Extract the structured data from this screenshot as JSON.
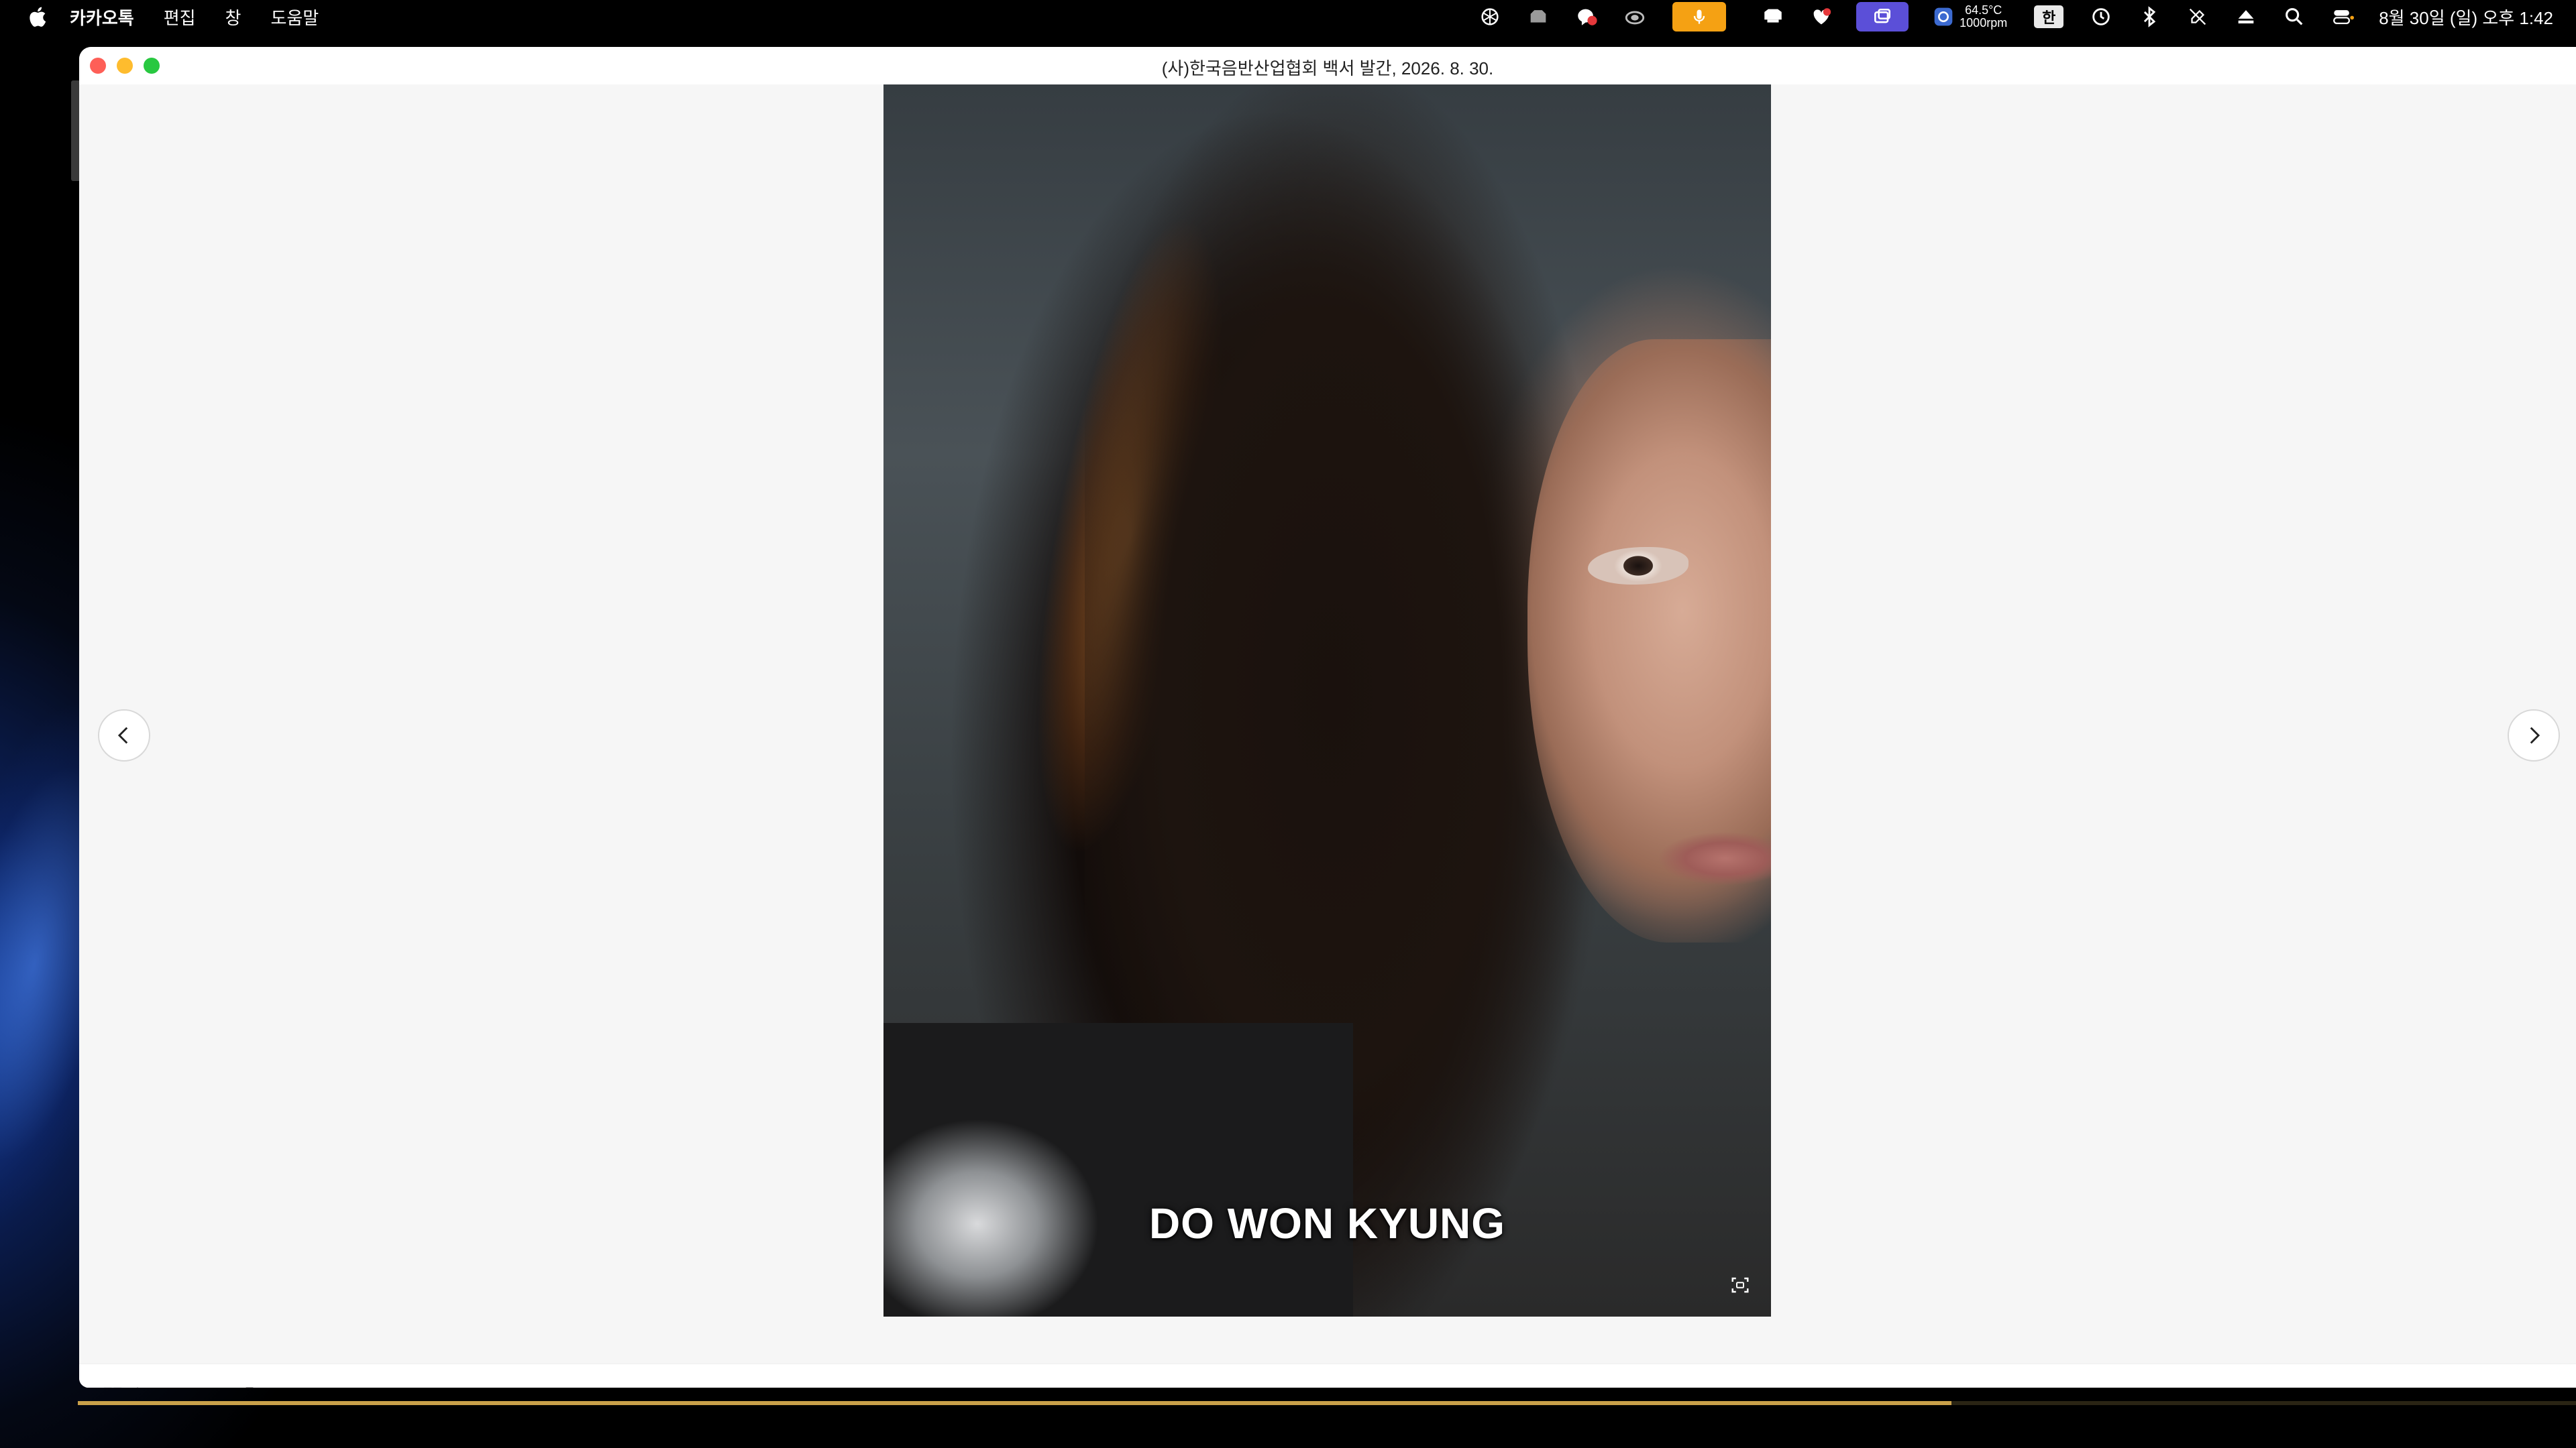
{
  "menubar": {
    "apple_icon": "apple-icon",
    "items": [
      {
        "label": "카카오톡",
        "bold": true
      },
      {
        "label": "편집",
        "bold": false
      },
      {
        "label": "창",
        "bold": false
      },
      {
        "label": "도움말",
        "bold": false
      }
    ],
    "status": {
      "temperature": "64.5°C",
      "fan_speed": "1000rpm",
      "input_method": "한",
      "clock": "8월 30일 (일) 오후 1:42"
    },
    "status_icons": [
      "openai-icon",
      "folder-icon",
      "chat-notification-icon",
      "cloud-icon",
      "microphone-icon",
      "screen-share-icon",
      "heart-icon",
      "display-mirror-icon",
      "fan-icon",
      "input-method-icon",
      "time-machine-icon",
      "bluetooth-icon",
      "pen-off-icon",
      "eject-icon",
      "search-icon",
      "control-center-icon"
    ]
  },
  "viewer": {
    "title": "(사)한국음반산업협회 백서 발간, 2026. 8. 30.",
    "photo_caption": "DO WON KYUNG",
    "toolbar": {
      "left_icons": [
        "grid-icon",
        "zoom-out-icon",
        "zoom-in-icon",
        "expand-icon",
        "rotate-icon"
      ],
      "right_icons": [
        "download-icon",
        "more-icon"
      ]
    },
    "colors": {
      "accent_mic": "#f5a113",
      "accent_purple": "#5b4fd8",
      "progress": "#c9a14a"
    }
  },
  "background_progress": 0.75
}
